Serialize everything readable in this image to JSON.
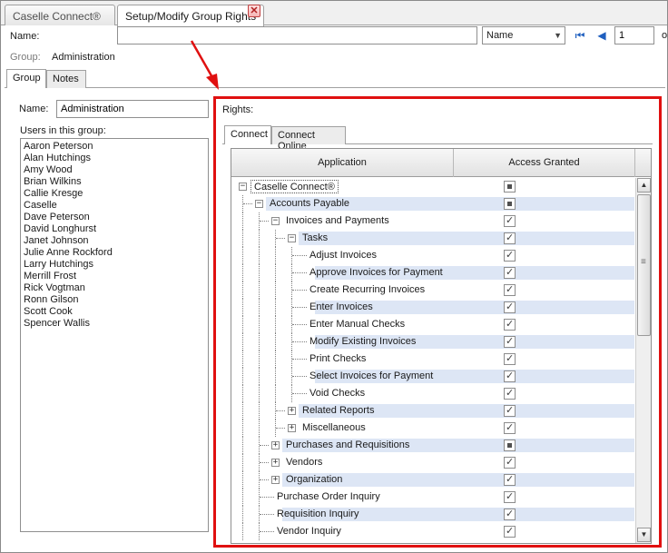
{
  "doc_tabs": [
    {
      "label": "Caselle Connect®",
      "active": false
    },
    {
      "label": "Setup/Modify Group Rights",
      "active": true
    }
  ],
  "close_glyph": "✕",
  "toolbar": {
    "name_label": "Name:",
    "name_value": "",
    "sort_value": "Name",
    "page_value": "1",
    "page_suffix": "o"
  },
  "group_info": {
    "label": "Group:",
    "value": "Administration"
  },
  "inner_tabs": [
    {
      "label": "Group",
      "active": true
    },
    {
      "label": "Notes",
      "active": false
    }
  ],
  "left": {
    "name_label": "Name:",
    "name_value": "Administration",
    "users_label": "Users in this group:",
    "users": [
      "Aaron Peterson",
      "Alan Hutchings",
      "Amy Wood",
      "Brian Wilkins",
      "Callie Kresge",
      "Caselle",
      "Dave Peterson",
      "David Longhurst",
      "Janet Johnson",
      "Julie Anne Rockford",
      "Larry Hutchings",
      "Merrill Frost",
      "Rick Vogtman",
      "Ronn Gilson",
      "Scott Cook",
      "Spencer Wallis"
    ]
  },
  "rights": {
    "label": "Rights:",
    "tabs": [
      {
        "label": "Connect",
        "active": true
      },
      {
        "label": "Connect Online",
        "active": false
      }
    ],
    "columns": {
      "application": "Application",
      "access": "Access Granted"
    },
    "tree": [
      {
        "label": "Caselle Connect®",
        "level": 0,
        "expander": "minus",
        "access": "partial",
        "hl": false,
        "selected": true
      },
      {
        "label": "Accounts Payable",
        "level": 1,
        "expander": "minus",
        "access": "partial",
        "hl": true
      },
      {
        "label": "Invoices and Payments",
        "level": 2,
        "expander": "minus",
        "access": "checked",
        "hl": false
      },
      {
        "label": "Tasks",
        "level": 3,
        "expander": "minus",
        "access": "checked",
        "hl": true
      },
      {
        "label": "Adjust Invoices",
        "level": 4,
        "expander": "none",
        "access": "checked",
        "hl": false
      },
      {
        "label": "Approve Invoices for Payment",
        "level": 4,
        "expander": "none",
        "access": "checked",
        "hl": true
      },
      {
        "label": "Create Recurring Invoices",
        "level": 4,
        "expander": "none",
        "access": "checked",
        "hl": false
      },
      {
        "label": "Enter Invoices",
        "level": 4,
        "expander": "none",
        "access": "checked",
        "hl": true
      },
      {
        "label": "Enter Manual Checks",
        "level": 4,
        "expander": "none",
        "access": "checked",
        "hl": false
      },
      {
        "label": "Modify Existing Invoices",
        "level": 4,
        "expander": "none",
        "access": "checked",
        "hl": true
      },
      {
        "label": "Print Checks",
        "level": 4,
        "expander": "none",
        "access": "checked",
        "hl": false
      },
      {
        "label": "Select Invoices for Payment",
        "level": 4,
        "expander": "none",
        "access": "checked",
        "hl": true
      },
      {
        "label": "Void Checks",
        "level": 4,
        "expander": "none",
        "access": "checked",
        "hl": false
      },
      {
        "label": "Related Reports",
        "level": 3,
        "expander": "plus",
        "access": "checked",
        "hl": true
      },
      {
        "label": "Miscellaneous",
        "level": 3,
        "expander": "plus",
        "access": "checked",
        "hl": false
      },
      {
        "label": "Purchases and Requisitions",
        "level": 2,
        "expander": "plus",
        "access": "partial",
        "hl": true
      },
      {
        "label": "Vendors",
        "level": 2,
        "expander": "plus",
        "access": "checked",
        "hl": false
      },
      {
        "label": "Organization",
        "level": 2,
        "expander": "plus",
        "access": "checked",
        "hl": true
      },
      {
        "label": "Purchase Order Inquiry",
        "level": 2,
        "expander": "none",
        "access": "checked",
        "hl": false
      },
      {
        "label": "Requisition Inquiry",
        "level": 2,
        "expander": "none",
        "access": "checked",
        "hl": true
      },
      {
        "label": "Vendor Inquiry",
        "level": 2,
        "expander": "none",
        "access": "checked",
        "hl": false
      }
    ]
  },
  "colors": {
    "callout": "#e01010",
    "highlight_row": "#dde6f5",
    "nav_blue": "#1f5fbf"
  }
}
